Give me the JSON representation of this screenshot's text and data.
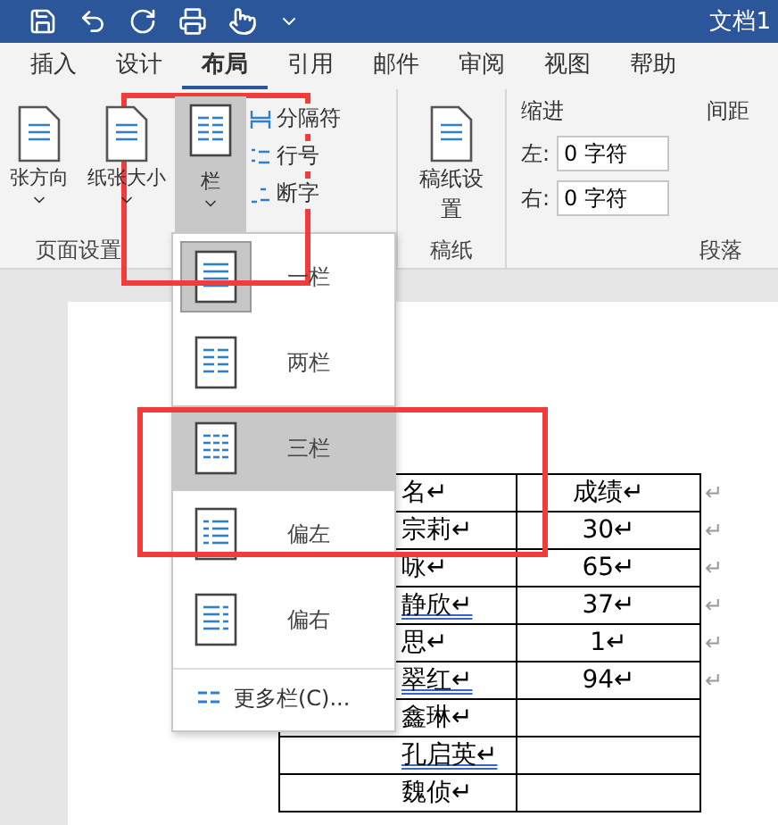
{
  "title_bar": {
    "title": "文档1"
  },
  "tabs": [
    {
      "label": "插入",
      "selected": false
    },
    {
      "label": "设计",
      "selected": false
    },
    {
      "label": "布局",
      "selected": true
    },
    {
      "label": "引用",
      "selected": false
    },
    {
      "label": "邮件",
      "selected": false
    },
    {
      "label": "审阅",
      "selected": false
    },
    {
      "label": "视图",
      "selected": false
    },
    {
      "label": "帮助",
      "selected": false
    }
  ],
  "ribbon": {
    "page_setup": {
      "orientation": "张方向",
      "size": "纸张大小",
      "columns": "栏",
      "columns_pressed": true,
      "breaks": "分隔符",
      "line_numbers": "行号",
      "hyphenation": "断字",
      "group": "页面设置"
    },
    "manuscript": {
      "button": "稿纸设置",
      "group": "稿纸"
    },
    "paragraph": {
      "indent": "缩进",
      "spacing": "间距",
      "left_label": "左:",
      "left_value": "0 字符",
      "right_label": "右:",
      "right_value": "0 字符",
      "group": "段落"
    }
  },
  "columns_menu": {
    "items": [
      {
        "kind": "one",
        "label": "一栏",
        "selected": true,
        "hovered": false
      },
      {
        "kind": "two",
        "label": "两栏",
        "selected": false,
        "hovered": false
      },
      {
        "kind": "three",
        "label": "三栏",
        "selected": false,
        "hovered": true
      },
      {
        "kind": "left",
        "label": "偏左",
        "selected": false,
        "hovered": false
      },
      {
        "kind": "right",
        "label": "偏右",
        "selected": false,
        "hovered": false
      }
    ],
    "more": "更多栏(C)..."
  },
  "table": {
    "rows": [
      {
        "name": "名↵",
        "score": "成绩↵",
        "flagged": false,
        "end": "↵"
      },
      {
        "name": "宗莉↵",
        "score": "30↵",
        "flagged": false,
        "end": "↵"
      },
      {
        "name": "咏↵",
        "score": "65↵",
        "flagged": false,
        "end": "↵"
      },
      {
        "name": "静欣↵",
        "score": "37↵",
        "flagged": true,
        "end": "↵"
      },
      {
        "name": "思↵",
        "score": "1↵",
        "flagged": false,
        "end": "↵"
      },
      {
        "name": "翠红↵",
        "score": "94↵",
        "flagged": true,
        "end": "↵"
      },
      {
        "name": "鑫琳↵",
        "score": "",
        "flagged": false,
        "end": ""
      },
      {
        "name": "孔启英↵",
        "score": "",
        "flagged": true,
        "end": ""
      },
      {
        "name": "魏侦↵",
        "score": "",
        "flagged": false,
        "end": ""
      }
    ]
  }
}
